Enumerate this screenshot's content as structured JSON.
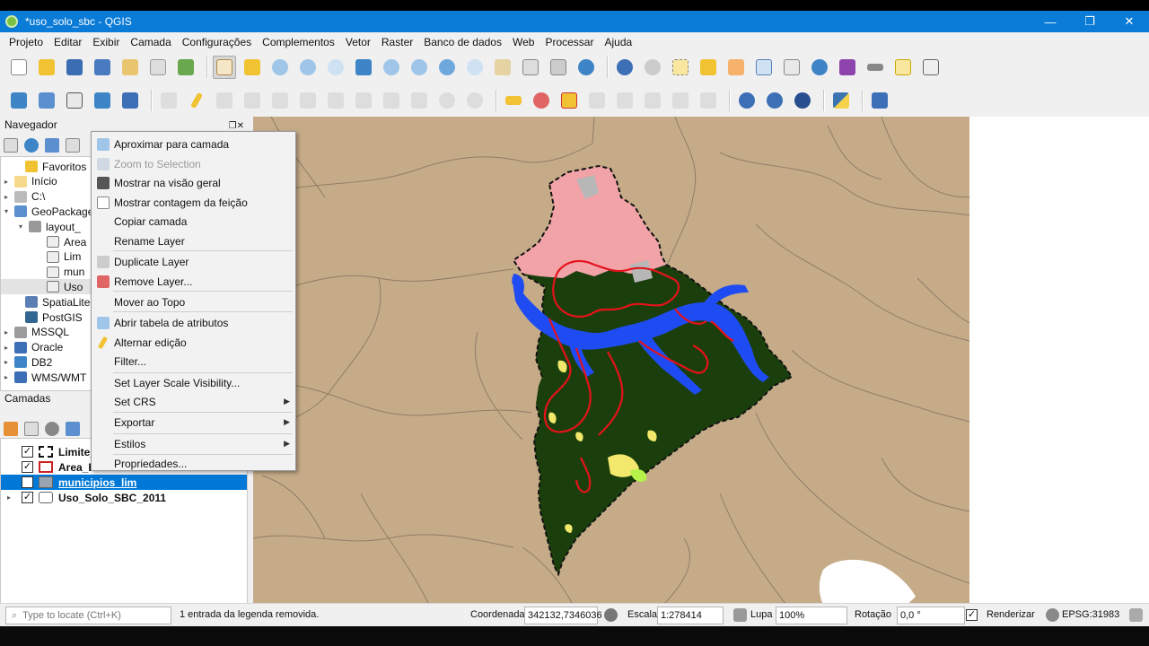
{
  "window": {
    "title": "*uso_solo_sbc - QGIS",
    "controls": [
      "—",
      "❐",
      "✕"
    ]
  },
  "menubar": [
    "Projeto",
    "Editar",
    "Exibir",
    "Camada",
    "Configurações",
    "Complementos",
    "Vetor",
    "Raster",
    "Banco de dados",
    "Web",
    "Processar",
    "Ajuda"
  ],
  "browser_panel": {
    "title": "Navegador",
    "items": [
      {
        "label": "Favoritos",
        "arrow": "",
        "icon": "star-icon"
      },
      {
        "label": "Início",
        "arrow": "▸",
        "icon": "home-folder-icon"
      },
      {
        "label": "C:\\",
        "arrow": "▸",
        "icon": "drive-icon"
      },
      {
        "label": "GeoPackage",
        "arrow": "▾",
        "icon": "geopackage-icon"
      },
      {
        "label": "layout_",
        "arrow": "▾",
        "icon": "database-icon"
      },
      {
        "label": "Area",
        "arrow": "",
        "icon": "polygon-layer-icon"
      },
      {
        "label": "Lim",
        "arrow": "",
        "icon": "polygon-layer-icon"
      },
      {
        "label": "mun",
        "arrow": "",
        "icon": "polygon-layer-icon"
      },
      {
        "label": "Uso",
        "arrow": "",
        "icon": "polygon-layer-icon"
      },
      {
        "label": "SpatiaLite",
        "arrow": "",
        "icon": "spatialite-icon"
      },
      {
        "label": "PostGIS",
        "arrow": "",
        "icon": "postgis-icon"
      },
      {
        "label": "MSSQL",
        "arrow": "▸",
        "icon": "mssql-icon"
      },
      {
        "label": "Oracle",
        "arrow": "▸",
        "icon": "oracle-icon"
      },
      {
        "label": "DB2",
        "arrow": "▸",
        "icon": "db2-icon"
      },
      {
        "label": "WMS/WMT",
        "arrow": "▸",
        "icon": "wms-icon"
      }
    ]
  },
  "layers_panel": {
    "title": "Camadas",
    "layers": [
      {
        "label": "Limite_",
        "checked": "✓",
        "arrow": "",
        "symbol": "dashed-outline"
      },
      {
        "label": "Area_Es",
        "checked": "✓",
        "arrow": "",
        "symbol": "red-outline"
      },
      {
        "label": "municipios_lim",
        "checked": "✓",
        "arrow": "",
        "symbol": "grey-fill"
      },
      {
        "label": "Uso_Solo_SBC_2011",
        "checked": "✓",
        "arrow": "▸",
        "symbol": "group-icon"
      }
    ]
  },
  "context_menu": [
    {
      "label": "Aproximar para camada",
      "icon": "zoom-layer-icon",
      "disabled": false,
      "submenu": false
    },
    {
      "label": "Zoom to Selection",
      "icon": "zoom-selection-icon",
      "disabled": true,
      "submenu": false
    },
    {
      "label": "Mostrar na visão geral",
      "icon": "overview-icon",
      "disabled": false,
      "submenu": false
    },
    {
      "label": "Mostrar contagem da feição",
      "icon": "checkbox-icon",
      "disabled": false,
      "submenu": false
    },
    {
      "label": "Copiar camada",
      "icon": "",
      "disabled": false,
      "submenu": false
    },
    {
      "label": "Rename Layer",
      "icon": "",
      "disabled": false,
      "submenu": false
    },
    {
      "label": "Duplicate Layer",
      "icon": "duplicate-icon",
      "disabled": false,
      "submenu": false
    },
    {
      "label": "Remove Layer...",
      "icon": "remove-icon",
      "disabled": false,
      "submenu": false
    },
    {
      "label": "Mover ao Topo",
      "icon": "",
      "disabled": false,
      "submenu": false
    },
    {
      "label": "Abrir tabela de atributos",
      "icon": "table-icon",
      "disabled": false,
      "submenu": false
    },
    {
      "label": "Alternar edição",
      "icon": "pencil-icon",
      "disabled": false,
      "submenu": false
    },
    {
      "label": "Filter...",
      "icon": "",
      "disabled": false,
      "submenu": false
    },
    {
      "label": "Set Layer Scale Visibility...",
      "icon": "",
      "disabled": false,
      "submenu": false
    },
    {
      "label": "Set CRS",
      "icon": "",
      "disabled": false,
      "submenu": true
    },
    {
      "label": "Exportar",
      "icon": "",
      "disabled": false,
      "submenu": true
    },
    {
      "label": "Estilos",
      "icon": "",
      "disabled": false,
      "submenu": true
    },
    {
      "label": "Propriedades...",
      "icon": "",
      "disabled": false,
      "submenu": false
    }
  ],
  "statusbar": {
    "locate_placeholder": "Type to locate (Ctrl+K)",
    "message": "1 entrada da legenda removida.",
    "coord_label": "Coordenada",
    "coord_value": "342132,7346036",
    "scale_label": "Escala",
    "scale_value": "1:278414",
    "magnifier_label": "Lupa",
    "magnifier_value": "100%",
    "rotation_label": "Rotação",
    "rotation_value": "0,0 °",
    "render_label": "Renderizar",
    "render_checked": "✓",
    "crs_label": "EPSG:31983"
  },
  "colors": {
    "titlebar": "#0a7bd6",
    "map_background": "#c6ab88",
    "urban_fill": "#f2a3a8",
    "forest": "#1b3f0c",
    "water": "#1f4cf2",
    "protected_area": "#e5121c",
    "selection": "#0078d7"
  }
}
